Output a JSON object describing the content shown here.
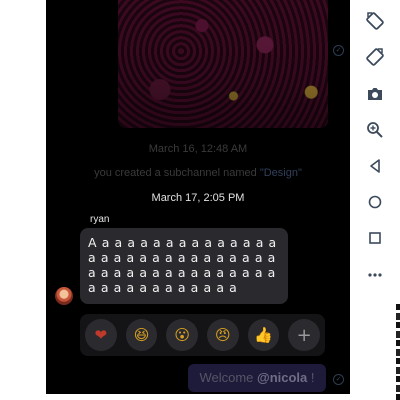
{
  "chat": {
    "date_1": "March 16, 12:48 AM",
    "system_message_prefix": "you created a subchannel named ",
    "channel_name": "\"Design\"",
    "date_2": "March 17, 2:05 PM",
    "sender": "ryan",
    "message": "A a a a a a a a a a a a a a a a a a a a a a a a a a a a a a a a a a a a a a a a a a a a a a a a a a a a a a a a a",
    "welcome_prefix": "Welcome ",
    "welcome_mention": "@nicola",
    "welcome_suffix": " !"
  },
  "reactions": [
    "❤",
    "😆",
    "😮",
    "😠",
    "👍",
    "+"
  ],
  "toolbar": {
    "icons": [
      "rotate-left-icon",
      "rotate-right-icon",
      "camera-icon",
      "zoom-in-icon",
      "back-icon",
      "home-icon",
      "overview-icon",
      "more-icon"
    ]
  },
  "colors": {
    "background": "#000000",
    "bubble": "#2a2a2e",
    "own_bubble": "#1d1a3a",
    "channel_accent": "#31405a"
  }
}
